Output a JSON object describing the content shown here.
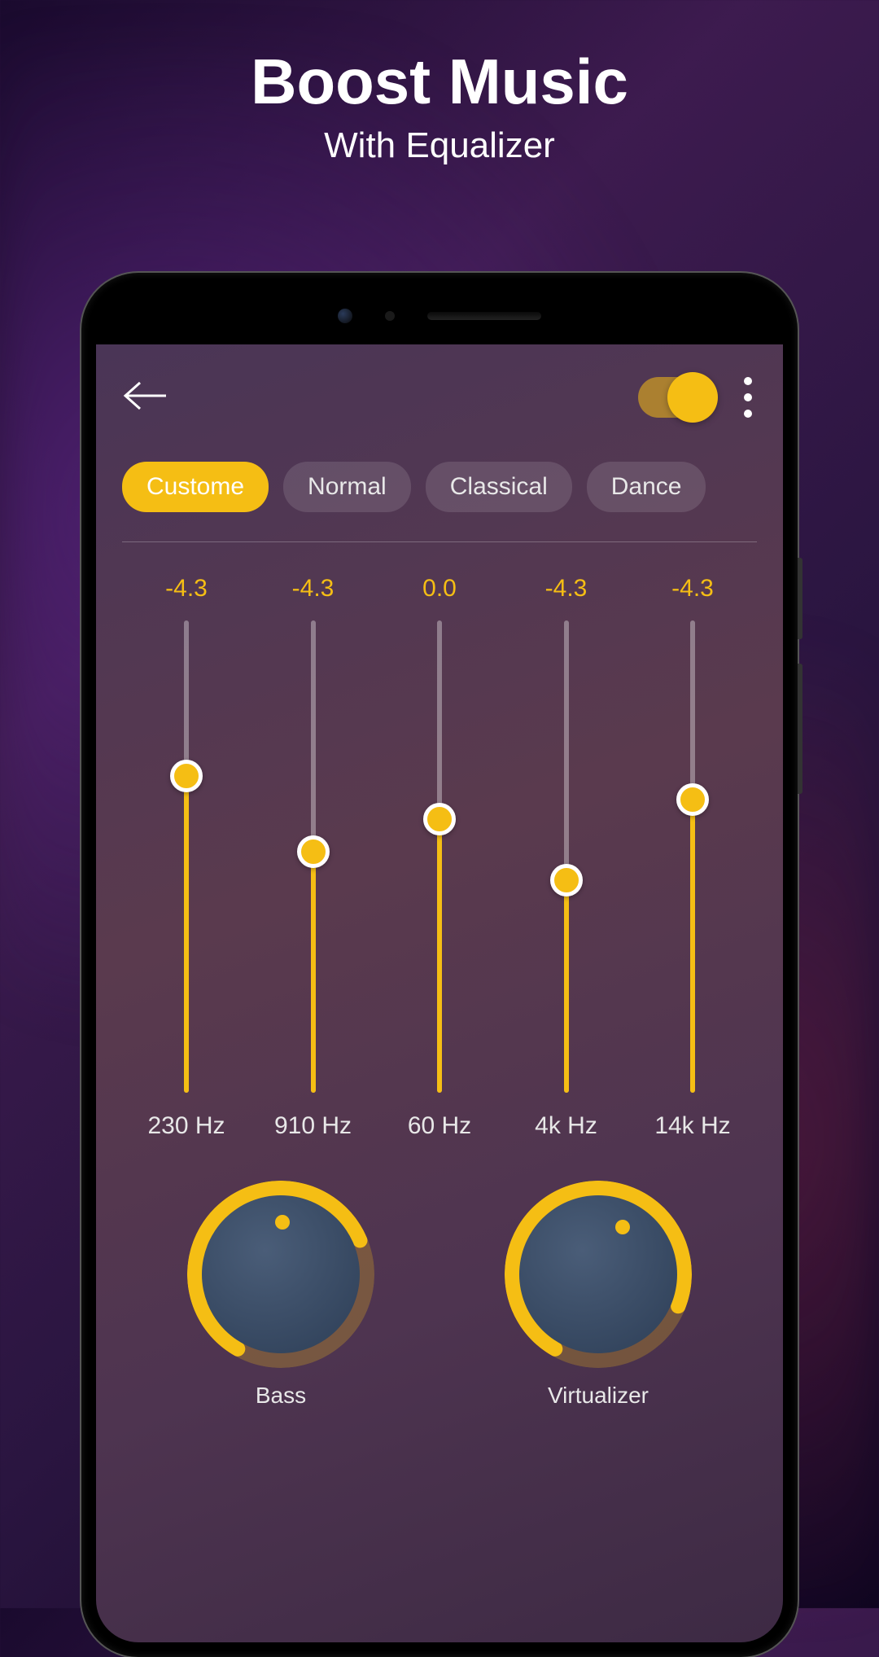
{
  "promo": {
    "title": "Boost Music",
    "subtitle": "With Equalizer"
  },
  "toggle_on": true,
  "presets": [
    {
      "label": "Custome",
      "active": true
    },
    {
      "label": "Normal",
      "active": false
    },
    {
      "label": "Classical",
      "active": false
    },
    {
      "label": "Dance",
      "active": false
    }
  ],
  "bands": [
    {
      "value": "-4.3",
      "freq": "230 Hz",
      "level_pct": 67
    },
    {
      "value": "-4.3",
      "freq": "910 Hz",
      "level_pct": 51
    },
    {
      "value": "0.0",
      "freq": "60 Hz",
      "level_pct": 58
    },
    {
      "value": "-4.3",
      "freq": "4k Hz",
      "level_pct": 45
    },
    {
      "value": "-4.3",
      "freq": "14k Hz",
      "level_pct": 62
    }
  ],
  "knobs": {
    "bass": {
      "label": "Bass",
      "angle_pct": 60
    },
    "virtualizer": {
      "label": "Virtualizer",
      "angle_pct": 72
    }
  },
  "colors": {
    "accent": "#f5be14"
  }
}
